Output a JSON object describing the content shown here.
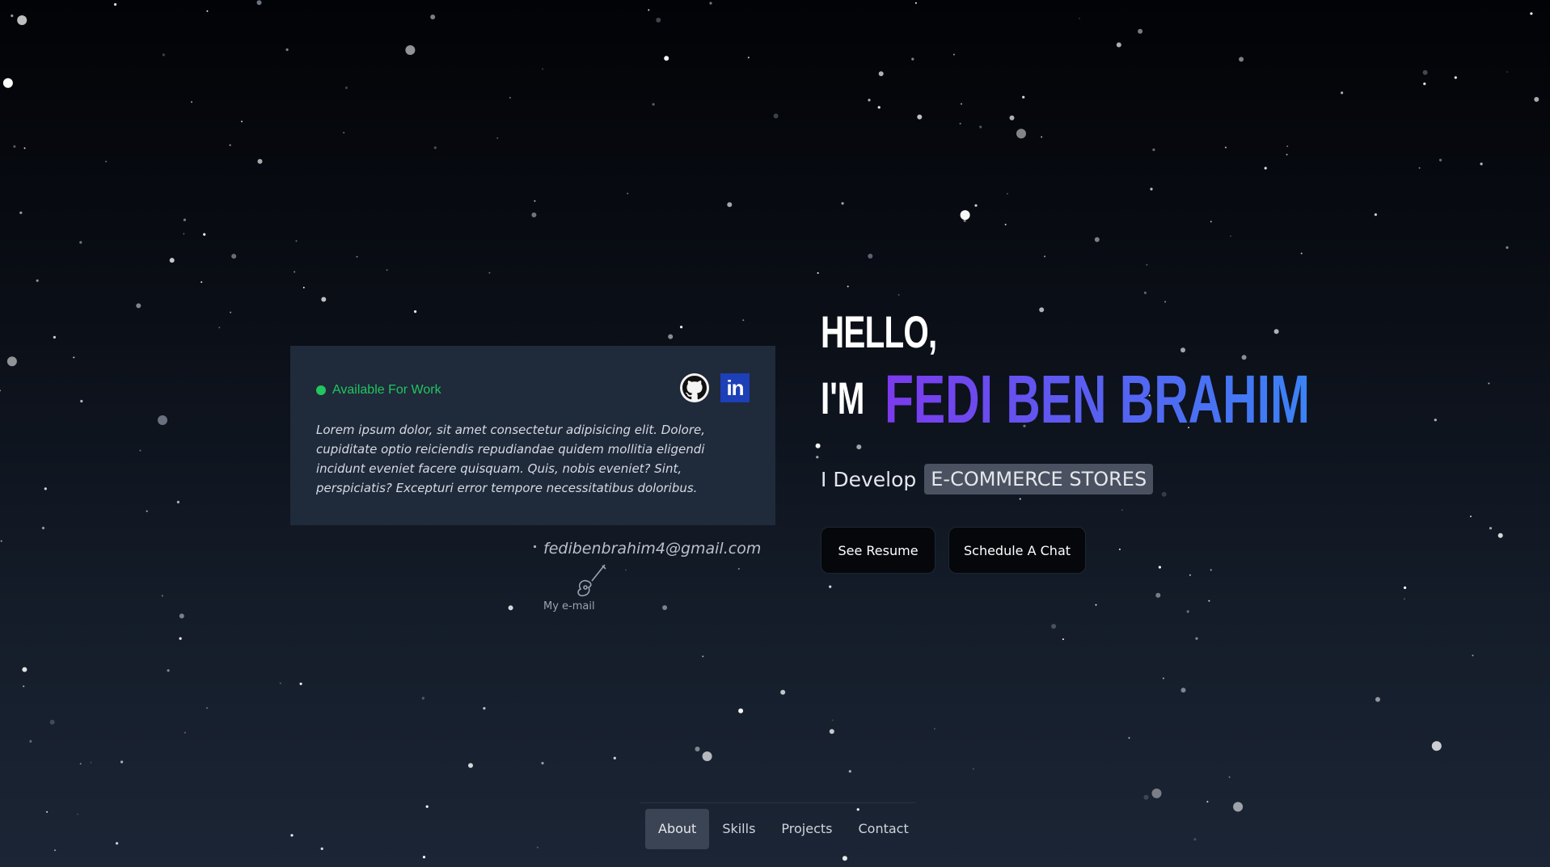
{
  "card": {
    "status": "Available For Work",
    "bio": "Lorem ipsum dolor, sit amet consectetur adipisicing elit. Dolore, cupiditate optio reiciendis repudiandae quidem mollitia eligendi incidunt eveniet facere quisquam. Quis, nobis eveniet? Sint, perspiciatis? Excepturi error tempore necessitatibus doloribus.",
    "social": [
      "github-icon",
      "linkedin-icon"
    ],
    "linkedin_glyph": "in"
  },
  "email": {
    "address": "fedibenbrahim4@gmail.com",
    "label": "My e-mail",
    "icon": "guitar-icon"
  },
  "hero": {
    "hello": "HELLO,",
    "im": "I'M",
    "name": "FEDI BEN BRAHIM",
    "develop_prefix": "I Develop",
    "develop_badge": "E-COMMERCE STORES"
  },
  "buttons": {
    "resume": "See Resume",
    "chat": "Schedule A Chat"
  },
  "nav": {
    "items": [
      "About",
      "Skills",
      "Projects",
      "Contact"
    ],
    "active": "About"
  },
  "colors": {
    "status": "#22c55e",
    "name_gradient_start": "#7c3aed",
    "name_gradient_end": "#3b82f6",
    "card_bg": "#1f2a3b"
  }
}
